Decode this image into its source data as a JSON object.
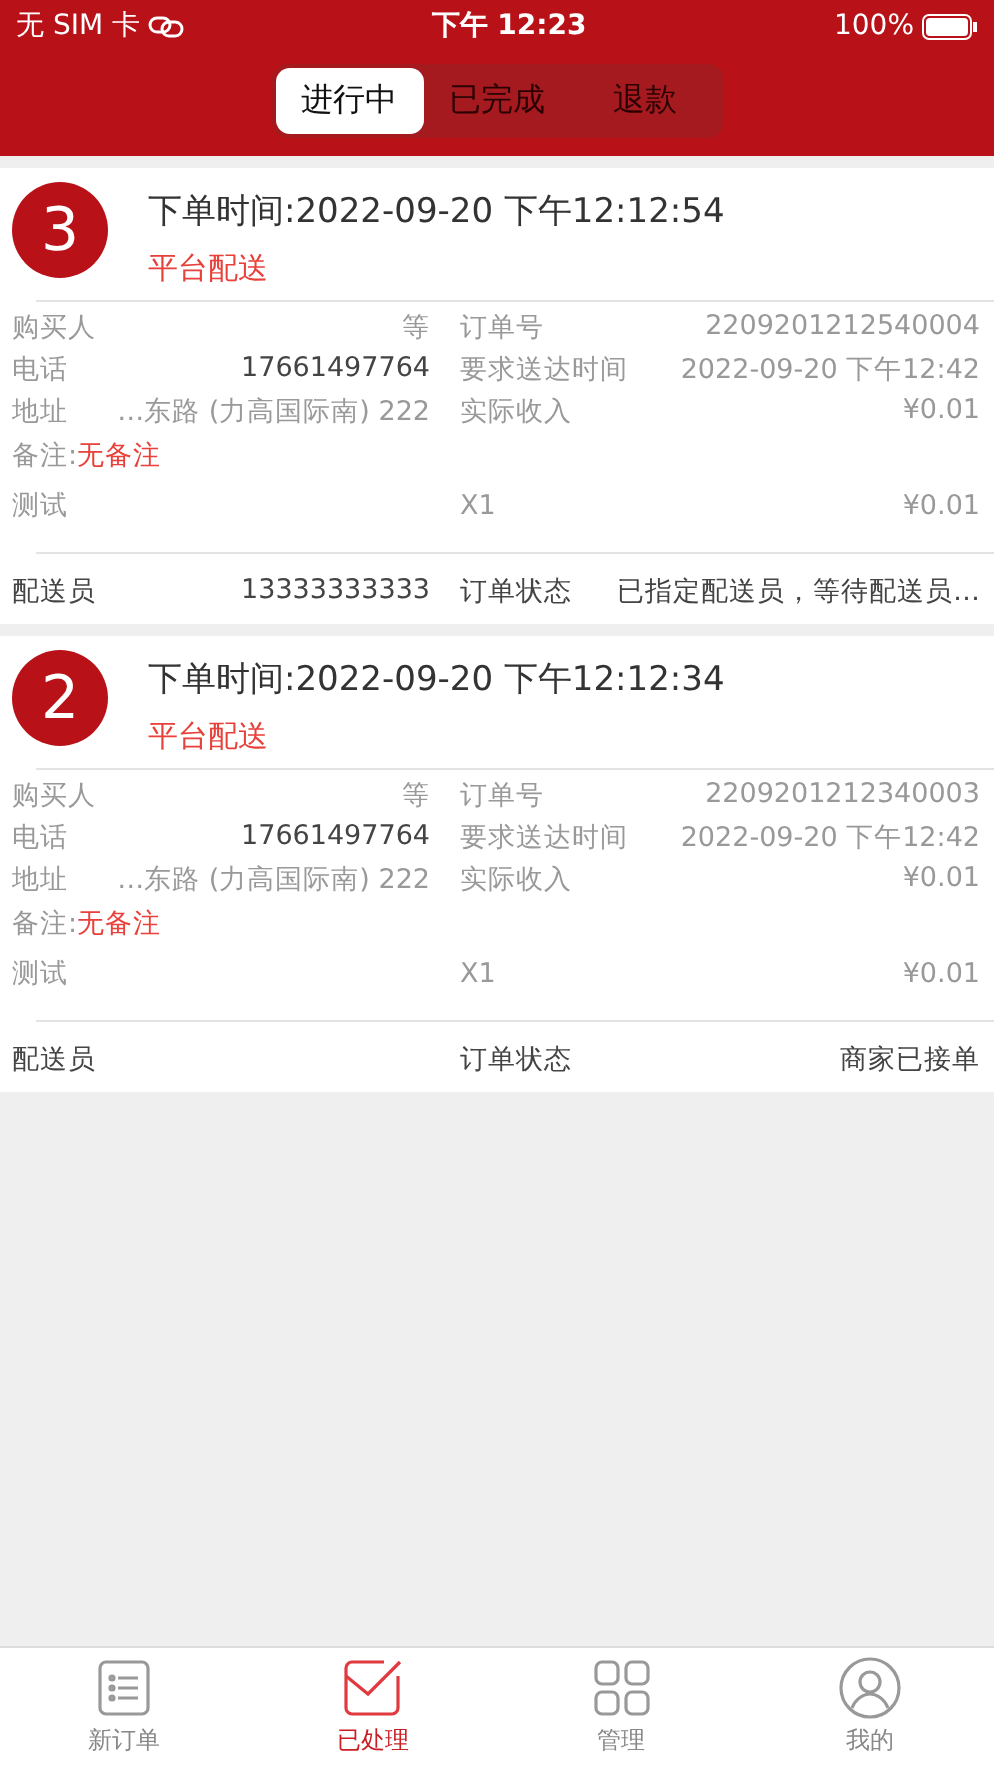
{
  "status_bar": {
    "carrier": "无 SIM 卡",
    "time": "下午 12:23",
    "battery": "100%"
  },
  "tabs": [
    {
      "label": "进行中",
      "selected": true
    },
    {
      "label": "已完成",
      "selected": false
    },
    {
      "label": "退款",
      "selected": false
    }
  ],
  "orders": [
    {
      "number": "3",
      "order_time": "下单时间:2022-09-20 下午12:12:54",
      "delivery_type": "平台配送",
      "buyer_label": "购买人",
      "buyer": "等",
      "order_no_label": "订单号",
      "order_no": "2209201212540004",
      "phone_label": "电话",
      "phone": "17661497764",
      "due_label": "要求送达时间",
      "due": "2022-09-20 下午12:42",
      "address_label": "地址",
      "address": "…东路 (力高国际南) 222",
      "income_label": "实际收入",
      "income": "¥0.01",
      "note_label": "备注:",
      "note": "无备注",
      "item_name": "测试",
      "item_qty": "X1",
      "item_price": "¥0.01",
      "courier_label": "配送员",
      "courier": "13333333333",
      "status_label": "订单状态",
      "status": "已指定配送员，等待配送员…"
    },
    {
      "number": "2",
      "order_time": "下单时间:2022-09-20 下午12:12:34",
      "delivery_type": "平台配送",
      "buyer_label": "购买人",
      "buyer": "等",
      "order_no_label": "订单号",
      "order_no": "2209201212340003",
      "phone_label": "电话",
      "phone": "17661497764",
      "due_label": "要求送达时间",
      "due": "2022-09-20 下午12:42",
      "address_label": "地址",
      "address": "…东路 (力高国际南) 222",
      "income_label": "实际收入",
      "income": "¥0.01",
      "note_label": "备注:",
      "note": "无备注",
      "item_name": "测试",
      "item_qty": "X1",
      "item_price": "¥0.01",
      "courier_label": "配送员",
      "status_label": "订单状态",
      "status": "商家已接单"
    }
  ],
  "tab_bar": [
    {
      "kind": "list",
      "label": "新订单",
      "selected": false
    },
    {
      "kind": "mail",
      "label": "已处理",
      "selected": true
    },
    {
      "kind": "grid",
      "label": "管理",
      "selected": false
    },
    {
      "kind": "user",
      "label": "我的",
      "selected": false
    }
  ]
}
